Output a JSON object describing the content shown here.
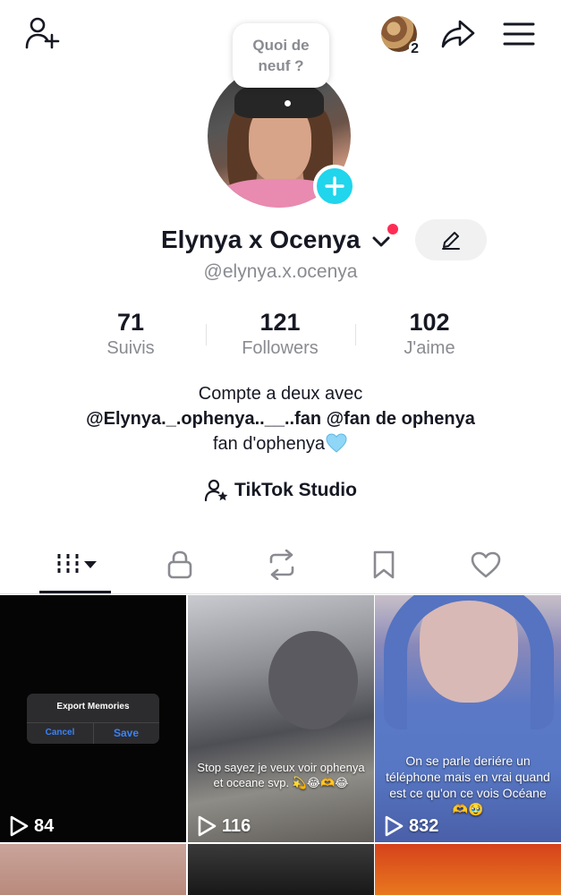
{
  "header": {
    "notification_count": "2",
    "icons": [
      "add-friend-icon",
      "share-icon",
      "hamburger-menu-icon"
    ]
  },
  "story_bubble": {
    "text": "Quoi de neuf ?"
  },
  "profile": {
    "display_name": "Elynya x Ocenya",
    "username": "@elynya.x.ocenya"
  },
  "stats": [
    {
      "value": "71",
      "label": "Suivis"
    },
    {
      "value": "121",
      "label": "Followers"
    },
    {
      "value": "102",
      "label": "J'aime"
    }
  ],
  "bio": {
    "line1": "Compte a deux avec",
    "line2": "@Elynya._.ophenya..__..fan @fan de ophenya",
    "line3": "fan d'ophenya"
  },
  "studio": {
    "label": "TikTok Studio"
  },
  "tabs": [
    "videos-grid-icon",
    "lock-icon",
    "repost-icon",
    "bookmark-icon",
    "heart-icon"
  ],
  "videos": [
    {
      "views": "84",
      "dialog": {
        "title": "Export Memories",
        "cancel": "Cancel",
        "save": "Save"
      }
    },
    {
      "views": "116",
      "caption": "Stop sayez je veux voir ophenya et oceane svp. 💫😂🫶😂"
    },
    {
      "views": "832",
      "caption": "On se parle deriére un téléphone mais en vrai quand est ce qu'on ce vois Océane🫶🥹"
    }
  ],
  "colors": {
    "accent": "#fe2c55",
    "story_add": "#20d5ec",
    "text_primary": "#161823",
    "text_secondary": "#8a8b91"
  }
}
